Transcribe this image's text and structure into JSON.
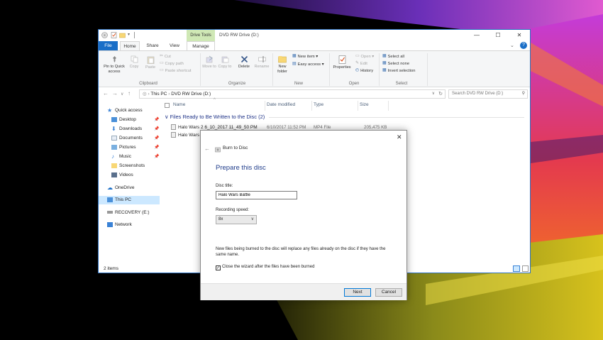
{
  "window": {
    "title": "DVD RW Drive (D:)",
    "context_tab": "Drive Tools"
  },
  "ribbon_tabs": [
    "File",
    "Home",
    "Share",
    "View",
    "Manage"
  ],
  "ribbon": {
    "clipboard": {
      "pin_label": "Pin to Quick access",
      "copy_label": "Copy",
      "paste_label": "Paste",
      "cut_label": "Cut",
      "copy_path_label": "Copy path",
      "paste_shortcut_label": "Paste shortcut",
      "group_label": "Clipboard"
    },
    "organize": {
      "move_to_label": "Move to",
      "copy_to_label": "Copy to",
      "delete_label": "Delete",
      "rename_label": "Rename",
      "group_label": "Organize"
    },
    "new": {
      "new_folder_label": "New folder",
      "new_item_label": "New item",
      "easy_access_label": "Easy access",
      "group_label": "New"
    },
    "open": {
      "properties_label": "Properties",
      "open_label": "Open",
      "edit_label": "Edit",
      "history_label": "History",
      "group_label": "Open"
    },
    "select": {
      "select_all_label": "Select all",
      "select_none_label": "Select none",
      "invert_selection_label": "Invert selection",
      "group_label": "Select"
    }
  },
  "address": {
    "path_root": "This PC",
    "path_current": "DVD RW Drive (D:)",
    "search_placeholder": "Search DVD RW Drive (D:)"
  },
  "nav": {
    "quick_access": "Quick access",
    "desktop": "Desktop",
    "downloads": "Downloads",
    "documents": "Documents",
    "pictures": "Pictures",
    "music": "Music",
    "screenshots": "Screenshots",
    "videos": "Videos",
    "onedrive": "OneDrive",
    "this_pc": "This PC",
    "recovery": "RECOVERY (E:)",
    "network": "Network"
  },
  "files": {
    "columns": {
      "name": "Name",
      "date": "Date modified",
      "type": "Type",
      "size": "Size"
    },
    "group_header": "Files Ready to Be Written to the Disc (2)",
    "rows": [
      {
        "name": "Halo Wars 2 6_10_2017 11_49_50 PM",
        "date": "6/10/2017 11:52 PM",
        "type": "MP4 File",
        "size": "205,475 KB"
      },
      {
        "name": "Halo Wars"
      }
    ]
  },
  "status": {
    "item_count": "2 items"
  },
  "dialog": {
    "title": "Burn to Disc",
    "heading": "Prepare this disc",
    "disc_title_label": "Disc title:",
    "disc_title_value": "Halo Wars Battle",
    "speed_label": "Recording speed:",
    "speed_value": "8x",
    "notice": "New files being burned to the disc will replace any files already on the disc if they have the same name.",
    "close_wizard_label": "Close the wizard after the files have been burned",
    "next_label": "Next",
    "cancel_label": "Cancel"
  },
  "colors": {
    "accent": "#1a6ec7",
    "drive_tools": "#cfe8b5",
    "heading_blue": "#1e3b8a"
  }
}
